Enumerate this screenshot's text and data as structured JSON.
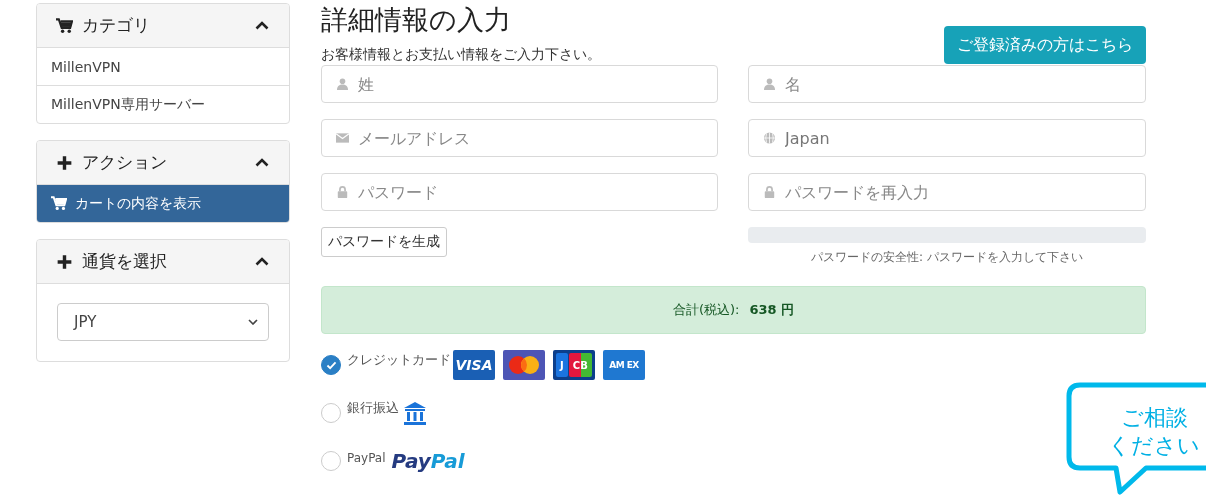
{
  "sidebar": [
    {
      "title": "カテゴリ",
      "expanded": true,
      "items": [
        {
          "label": "MillenVPN",
          "selected": false
        },
        {
          "label": "MillenVPN専用サーバー",
          "selected": false
        }
      ]
    },
    {
      "title": "アクション",
      "expanded": true,
      "items": [
        {
          "label": "カートの内容を表示",
          "selected": true
        }
      ]
    },
    {
      "title": "通貨を選択",
      "expanded": true,
      "select": {
        "value": "JPY"
      }
    }
  ],
  "page": {
    "title": "詳細情報の入力",
    "subtitle": "お客様情報とお支払い情報をご入力下さい。",
    "login_button": "ご登録済みの方はこちら"
  },
  "fields": [
    {
      "kind": "name",
      "placeholder": "姓"
    },
    {
      "kind": "name",
      "placeholder": "名"
    },
    {
      "kind": "email",
      "placeholder": "メールアドレス"
    },
    {
      "kind": "country",
      "value": "Japan"
    },
    {
      "kind": "password",
      "placeholder": "パスワード"
    },
    {
      "kind": "password",
      "placeholder": "パスワードを再入力"
    }
  ],
  "generate_button": "パスワードを生成",
  "strength": {
    "label": "パスワードの安全性: パスワードを入力して下さい"
  },
  "total": {
    "label": "合計(税込):",
    "amount": "638 円"
  },
  "payment_methods": [
    {
      "kind": "card",
      "label": "クレジットカード",
      "selected": true,
      "logos": [
        {
          "kind": "visa",
          "text": "VISA"
        },
        {
          "kind": "mastercard"
        },
        {
          "kind": "jcb",
          "text": [
            "J",
            "CB"
          ]
        },
        {
          "kind": "amex",
          "text": "AM EX"
        }
      ]
    },
    {
      "kind": "bank",
      "label": "銀行振込",
      "selected": false
    },
    {
      "kind": "paypal",
      "label": "PayPal",
      "selected": false,
      "logo": [
        "Pay",
        "Pal"
      ]
    }
  ],
  "chat_bubble": {
    "lines": [
      "ご相談",
      "ください"
    ]
  }
}
